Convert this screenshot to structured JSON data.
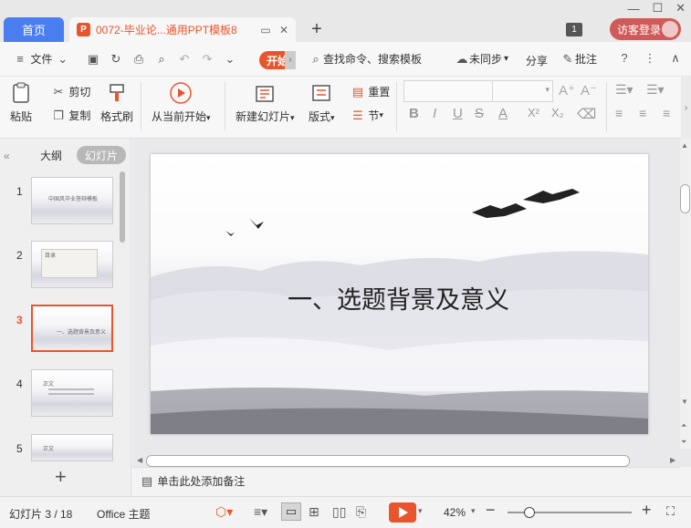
{
  "tabs": {
    "home": "首页",
    "document": "0072-毕业论...通用PPT模板8",
    "new_tab": "+"
  },
  "window": {
    "badge": "1",
    "login": "访客登录"
  },
  "menu": {
    "file": "文件",
    "start": "开始",
    "search": "查找命令、搜索模板",
    "sync": "未同步",
    "share": "分享",
    "comment": "批注"
  },
  "ribbon": {
    "paste": "粘贴",
    "cut": "剪切",
    "copy": "复制",
    "format_painter": "格式刷",
    "from_start": "从当前开始",
    "new_slide": "新建幻灯片",
    "layout": "版式",
    "reset": "重置",
    "section": "节"
  },
  "left_panel": {
    "outline": "大纲",
    "slides": "幻灯片",
    "thumbnails": [
      {
        "num": "1",
        "text": "中国风毕业答辩模板"
      },
      {
        "num": "2",
        "text": "目录"
      },
      {
        "num": "3",
        "text": "一、选题背景及意义"
      },
      {
        "num": "4",
        "text": "正文"
      },
      {
        "num": "5",
        "text": "正文"
      }
    ],
    "add": "+"
  },
  "slide": {
    "title": "一、选题背景及意义"
  },
  "notes": {
    "placeholder": "单击此处添加备注"
  },
  "status": {
    "slide_counter": "幻灯片 3 / 18",
    "theme": "Office 主题",
    "zoom": "42%"
  },
  "colors": {
    "accent": "#e8552c",
    "home_tab": "#4a7df0",
    "login": "#d05a5a"
  }
}
